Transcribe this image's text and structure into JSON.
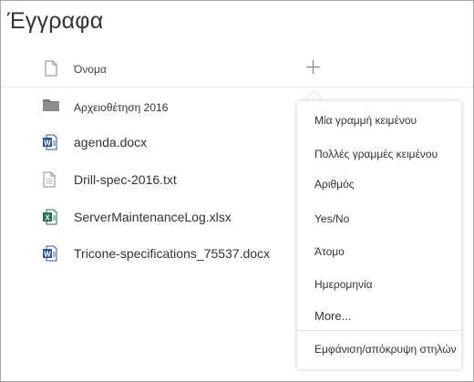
{
  "page": {
    "title": "Έγγραφα"
  },
  "columns": {
    "name": "Όνομα"
  },
  "files": [
    {
      "name": "Αρχειοθέτηση 2016",
      "icon": "folder-icon"
    },
    {
      "name": "agenda.docx",
      "icon": "word-doc-icon"
    },
    {
      "name": "Drill-spec-2016.txt",
      "icon": "text-file-icon"
    },
    {
      "name": "ServerMaintenanceLog.xlsx",
      "icon": "excel-file-icon"
    },
    {
      "name": "Tricone-specifications_75537.docx",
      "icon": "word-doc-icon"
    }
  ],
  "add_column_menu": {
    "items": [
      "Μία γραμμή κειμένου",
      "Πολλές γραμμές κειμένου",
      "Αριθμός",
      "Yes/No",
      "Άτομο",
      "Ημερομηνία",
      "More..."
    ],
    "footer": "Εμφάνιση/απόκρυψη στηλών"
  },
  "colors": {
    "word": "#2b579a",
    "excel": "#217346",
    "folder": "#7a7a7a",
    "text": "#333333"
  }
}
